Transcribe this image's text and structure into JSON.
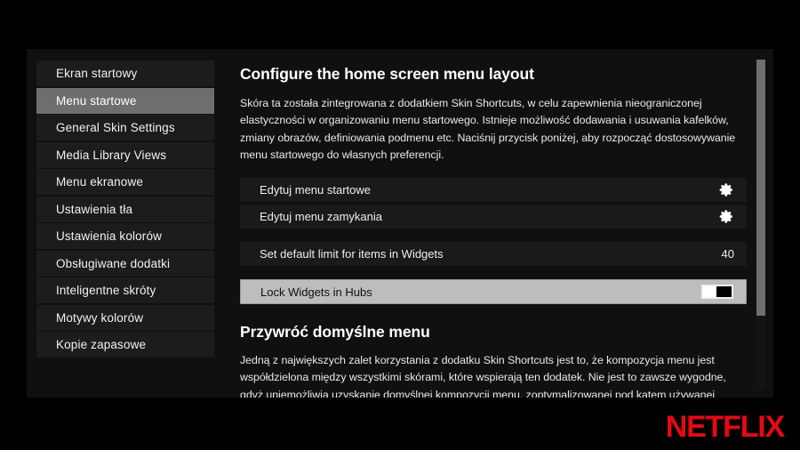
{
  "colors": {
    "accent_red": "#e50914",
    "panel_bg": "#101010",
    "row_bg": "#1a1a1a",
    "selected_bg": "#6e6e6e",
    "highlight_bg": "#bdbdbd"
  },
  "sidebar": {
    "items": [
      {
        "label": "Ekran startowy",
        "selected": false
      },
      {
        "label": "Menu startowe",
        "selected": true
      },
      {
        "label": "General Skin Settings",
        "selected": false
      },
      {
        "label": "Media Library Views",
        "selected": false
      },
      {
        "label": "Menu ekranowe",
        "selected": false
      },
      {
        "label": "Ustawienia tła",
        "selected": false
      },
      {
        "label": "Ustawienia kolorów",
        "selected": false
      },
      {
        "label": "Obsługiwane dodatki",
        "selected": false
      },
      {
        "label": "Inteligentne skróty",
        "selected": false
      },
      {
        "label": "Motywy kolorów",
        "selected": false
      },
      {
        "label": "Kopie zapasowe",
        "selected": false
      }
    ]
  },
  "main": {
    "section1": {
      "title": "Configure the home screen menu layout",
      "description": "Skóra ta została zintegrowana z dodatkiem Skin Shortcuts, w celu zapewnienia nieograniczonej elastyczności w organizowaniu menu startowego. Istnieje możliwość dodawania i usuwania kafelków, zmiany obrazów, definiowania podmenu etc. Naciśnij przycisk poniżej, aby rozpocząć dostosowywanie menu startowego do własnych preferencji."
    },
    "rows": [
      {
        "label": "Edytuj menu startowe",
        "control": "gear-icon",
        "value": ""
      },
      {
        "label": "Edytuj menu zamykania",
        "control": "gear-icon",
        "value": ""
      },
      {
        "label": "Set default limit for items in Widgets",
        "control": "value",
        "value": "40"
      },
      {
        "label": "Lock Widgets in Hubs",
        "control": "toggle",
        "value": "off"
      }
    ],
    "section2": {
      "title": "Przywróć domyślne menu",
      "description": "Jedną z największych zalet korzystania z dodatku Skin Shortcuts jest to, że kompozycja menu jest współdzielona między wszystkimi skórami, które wspierają ten dodatek. Nie jest to zawsze wygodne, gdyż uniemożliwia uzyskanie domyślnej kompozycji menu, zoptymalizowanej pod kątem używanej skóry. Jeśli zauważysz dziwne zachowanie menu startowego lub po prostu chcesz rozpocząć od nowa i"
    }
  },
  "branding": {
    "logo_text": "NETFLIX"
  }
}
